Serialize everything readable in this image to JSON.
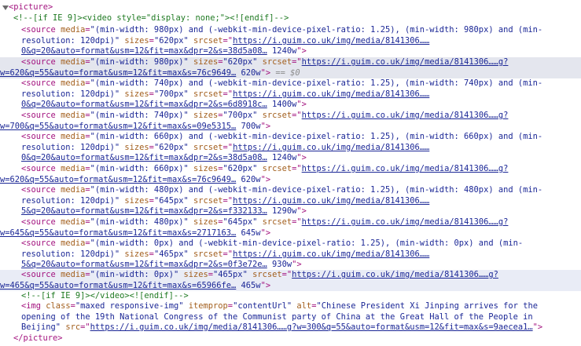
{
  "top_fragment": "",
  "picture_open": "<picture>",
  "picture_close": "</picture>",
  "comment_open": "<!--[if IE 9]><video style=\"display: none;\"><![endif]-->",
  "comment_close": "<!--[if IE 9]></video><![endif]-->",
  "selected_marker": "== $0",
  "sources": [
    {
      "l1": {
        "tag": "<source",
        "a1": "media",
        "v1": "\"(min-width: 980px) and (-webkit-min-device-pixel-ratio: 1.25), (min-width: 980px) and (min-"
      },
      "l2": {
        "v": "resolution: 120dpi)\"",
        "a": "sizes",
        "vs": "\"620px\"",
        "a2": "srcset",
        "q": "=\"",
        "url": "https://i.guim.co.uk/img/media/8141306……"
      },
      "l3": {
        "url": "0&q=20&auto=format&usm=12&fit=max&dpr=2&s=38d5a08…",
        "tail": " 1240w",
        "end": "\">"
      }
    },
    {
      "l1": {
        "tag": "<source",
        "a1": "media",
        "v1": "\"(min-width: 980px)\"",
        "a": "sizes",
        "vs": "\"620px\"",
        "a2": "srcset",
        "q": "=\"",
        "url": "https://i.guim.co.uk/img/media/8141306……g?"
      },
      "l2": {
        "url": "w=620&q=55&auto=format&usm=12&fit=max&s=76c9649…",
        "tail": " 620w",
        "end": "\">"
      }
    },
    {
      "l1": {
        "tag": "<source",
        "a1": "media",
        "v1": "\"(min-width: 740px) and (-webkit-min-device-pixel-ratio: 1.25), (min-width: 740px) and (min-"
      },
      "l2": {
        "v": "resolution: 120dpi)\"",
        "a": "sizes",
        "vs": "\"700px\"",
        "a2": "srcset",
        "q": "=\"",
        "url": "https://i.guim.co.uk/img/media/8141306……"
      },
      "l3": {
        "url": "0&q=20&auto=format&usm=12&fit=max&dpr=2&s=6d8918c…",
        "tail": " 1400w",
        "end": "\">"
      }
    },
    {
      "l1": {
        "tag": "<source",
        "a1": "media",
        "v1": "\"(min-width: 740px)\"",
        "a": "sizes",
        "vs": "\"700px\"",
        "a2": "srcset",
        "q": "=\"",
        "url": "https://i.guim.co.uk/img/media/8141306……g?"
      },
      "l2": {
        "url": "w=700&q=55&auto=format&usm=12&fit=max&s=09e5315…",
        "tail": " 700w",
        "end": "\">"
      }
    },
    {
      "l1": {
        "tag": "<source",
        "a1": "media",
        "v1": "\"(min-width: 660px) and (-webkit-min-device-pixel-ratio: 1.25), (min-width: 660px) and (min-"
      },
      "l2": {
        "v": "resolution: 120dpi)\"",
        "a": "sizes",
        "vs": "\"620px\"",
        "a2": "srcset",
        "q": "=\"",
        "url": "https://i.guim.co.uk/img/media/8141306……"
      },
      "l3": {
        "url": "0&q=20&auto=format&usm=12&fit=max&dpr=2&s=38d5a08…",
        "tail": " 1240w",
        "end": "\">"
      }
    },
    {
      "l1": {
        "tag": "<source",
        "a1": "media",
        "v1": "\"(min-width: 660px)\"",
        "a": "sizes",
        "vs": "\"620px\"",
        "a2": "srcset",
        "q": "=\"",
        "url": "https://i.guim.co.uk/img/media/8141306……g?"
      },
      "l2": {
        "url": "w=620&q=55&auto=format&usm=12&fit=max&s=76c9649…",
        "tail": " 620w",
        "end": "\">"
      }
    },
    {
      "l1": {
        "tag": "<source",
        "a1": "media",
        "v1": "\"(min-width: 480px) and (-webkit-min-device-pixel-ratio: 1.25), (min-width: 480px) and (min-"
      },
      "l2": {
        "v": "resolution: 120dpi)\"",
        "a": "sizes",
        "vs": "\"645px\"",
        "a2": "srcset",
        "q": "=\"",
        "url": "https://i.guim.co.uk/img/media/8141306……"
      },
      "l3": {
        "url": "5&q=20&auto=format&usm=12&fit=max&dpr=2&s=f332133…",
        "tail": " 1290w",
        "end": "\">"
      }
    },
    {
      "l1": {
        "tag": "<source",
        "a1": "media",
        "v1": "\"(min-width: 480px)\"",
        "a": "sizes",
        "vs": "\"645px\"",
        "a2": "srcset",
        "q": "=\"",
        "url": "https://i.guim.co.uk/img/media/8141306……g?"
      },
      "l2": {
        "url": "w=645&q=55&auto=format&usm=12&fit=max&s=2717163…",
        "tail": " 645w",
        "end": "\">"
      }
    },
    {
      "l1": {
        "tag": "<source",
        "a1": "media",
        "v1": "\"(min-width: 0px) and (-webkit-min-device-pixel-ratio: 1.25), (min-width: 0px) and (min-"
      },
      "l2": {
        "v": "resolution: 120dpi)\"",
        "a": "sizes",
        "vs": "\"465px\"",
        "a2": "srcset",
        "q": "=\"",
        "url": "https://i.guim.co.uk/img/media/8141306……"
      },
      "l3": {
        "url": "5&q=20&auto=format&usm=12&fit=max&dpr=2&s=0f3e72e…",
        "tail": " 930w",
        "end": "\">"
      }
    },
    {
      "l1": {
        "tag": "<source",
        "a1": "media",
        "v1": "\"(min-width: 0px)\"",
        "a": "sizes",
        "vs": "\"465px\"",
        "a2": "srcset",
        "q": "=\"",
        "url": "https://i.guim.co.uk/img/media/8141306……g?"
      },
      "l2": {
        "url": "w=465&q=55&auto=format&usm=12&fit=max&s=65966fe…",
        "tail": " 465w",
        "end": "\">"
      }
    }
  ],
  "img": {
    "tag": "<img",
    "a_class": "class",
    "v_class": "\"maxed responsive-img\"",
    "a_itemprop": "itemprop",
    "v_itemprop": "\"contentUrl\"",
    "a_alt": "alt",
    "v_alt_1": "\"Chinese President Xi Jinping arrives for the",
    "v_alt_2": "opening of the 19th National Congress of the Communist party of China at the Great Hall of the People in",
    "v_alt_3": "Beijing\"",
    "a_src": "src",
    "src_url": "https://i.guim.co.uk/img/media/8141306……g?w=300&q=55&auto=format&usm=12&fit=max&s=9aecea1…",
    "end": "\">"
  },
  "colors": {
    "tag": "#a3137f",
    "attr": "#a25e1c",
    "value": "#1b2796",
    "comment": "#1f7a22",
    "selected_bg": "#e4e6ee"
  }
}
